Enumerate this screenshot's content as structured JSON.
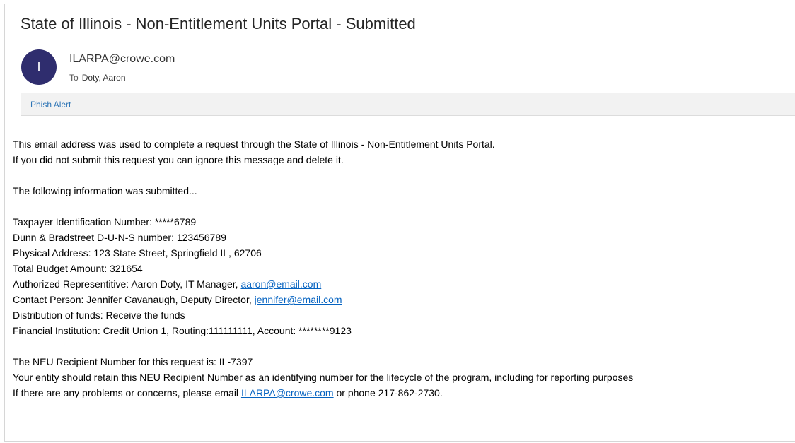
{
  "email": {
    "subject": "State of Illinois - Non-Entitlement Units Portal - Submitted",
    "avatar_initial": "I",
    "avatar_color": "#2f2d6e",
    "sender": "ILARPA@crowe.com",
    "to_label": "To",
    "to_name": "Doty, Aaron",
    "phish_alert_label": "Phish Alert",
    "link_color": "#0563c1"
  },
  "body": {
    "intro_1": "This email address was used to complete a request through the State of Illinois - Non-Entitlement Units Portal.",
    "intro_2": "If you did not submit this request you can ignore this message and delete it.",
    "submitted_heading": "The following information was submitted...",
    "tin": "Taxpayer Identification Number: *****6789",
    "duns": "Dunn & Bradstreet D-U-N-S number: 123456789",
    "address": "Physical Address: 123 State Street, Springfield IL, 62706",
    "budget": "Total Budget Amount: 321654",
    "auth_rep_prefix": "Authorized Representitive: Aaron Doty, IT Manager, ",
    "auth_rep_email": "aaron@email.com",
    "contact_prefix": "Contact Person: Jennifer Cavanaugh, Deputy Director, ",
    "contact_email": "jennifer@email.com",
    "distribution": "Distribution of funds: Receive the funds",
    "financial": "Financial Institution: Credit Union 1, Routing:111111111, Account: ********9123",
    "neu_number": "The NEU Recipient Number for this request is: IL-7397",
    "retain": "Your entity should retain this NEU Recipient Number as an identifying number for the lifecycle of the program, including for reporting purposes",
    "problems_prefix": "If there are any problems or concerns, please email ",
    "problems_email": "ILARPA@crowe.com",
    "problems_suffix": " or phone 217-862-2730."
  }
}
